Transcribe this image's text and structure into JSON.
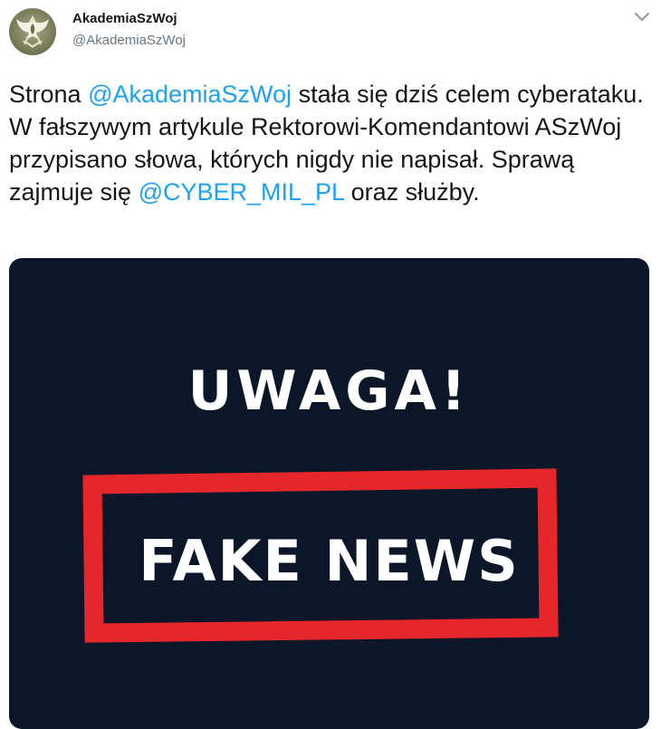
{
  "tweet": {
    "display_name": "AkademiaSzWoj",
    "handle": "@AkademiaSzWoj",
    "avatar_icon": "military-eagle-emblem-icon",
    "menu_icon": "chevron-down-icon",
    "text": {
      "part1": "Strona ",
      "mention1": "@AkademiaSzWoj",
      "part2": " stała się dziś celem cyberataku. W fałszywym artykule Rektorowi-Komendantowi ASzWoj przypisano słowa, których nigdy nie napisał. Sprawą zajmuje się ",
      "mention2": "@CYBER_MIL_PL",
      "part3": " oraz służby."
    },
    "media": {
      "headline": "UWAGA!",
      "stamp_text": "FAKE NEWS",
      "background_color": "#0b1628",
      "stamp_color": "#e5262b"
    }
  },
  "colors": {
    "link": "#1da1f2",
    "secondary_text": "#657786",
    "primary_text": "#14171a"
  }
}
